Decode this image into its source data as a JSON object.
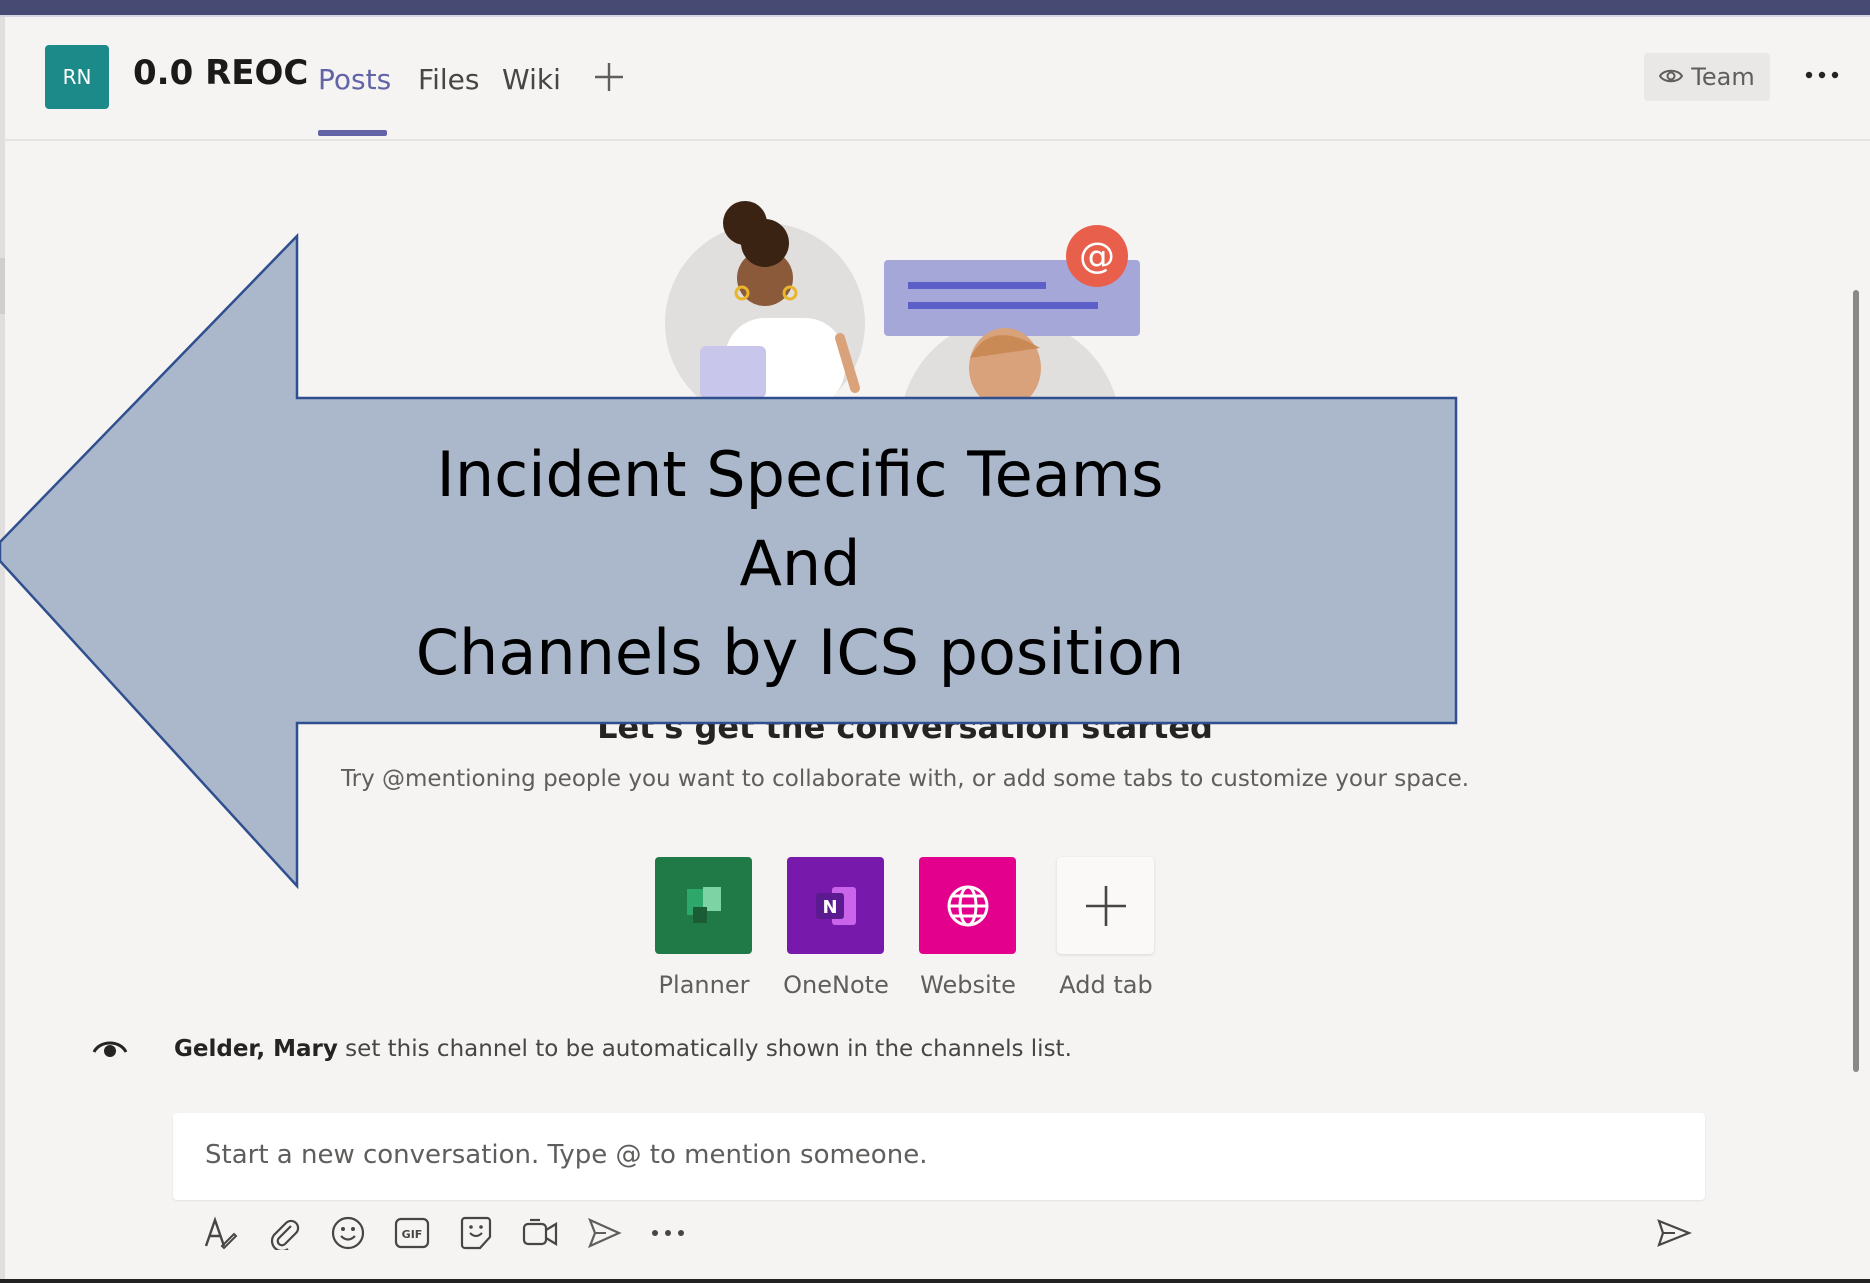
{
  "header": {
    "avatar_initials": "RN",
    "team_name": "0.0 REOC",
    "tabs": [
      {
        "label": "Posts",
        "active": true
      },
      {
        "label": "Files",
        "active": false
      },
      {
        "label": "Wiki",
        "active": false
      }
    ],
    "add_tab_icon": "plus-icon",
    "team_button_label": "Team",
    "more_icon": "more-horizontal-icon"
  },
  "empty_state": {
    "title": "Let's get the conversation started",
    "subtitle": "Try @mentioning people you want to collaborate with, or add some tabs to customize your space."
  },
  "apps": [
    {
      "label": "Planner",
      "color": "#1f7a48",
      "icon": "planner-icon"
    },
    {
      "label": "OneNote",
      "color": "#7719aa",
      "icon": "onenote-icon"
    },
    {
      "label": "Website",
      "color": "#e3008c",
      "icon": "globe-icon"
    },
    {
      "label": "Add tab",
      "color": "#faf9f8",
      "icon": "plus-icon"
    }
  ],
  "system_message": {
    "author": "Gelder, Mary",
    "text": " set this channel to be automatically shown in the channels list."
  },
  "compose": {
    "placeholder": "Start a new conversation. Type @ to mention someone."
  },
  "toolbar_icons": [
    "format-icon",
    "attach-icon",
    "emoji-icon",
    "gif-icon",
    "sticker-icon",
    "meet-now-icon",
    "stream-icon",
    "more-options-icon",
    "send-icon"
  ],
  "overlay": {
    "line1": "Incident Specific Teams",
    "line2": "And",
    "line3": "Channels by ICS position",
    "fill": "#abb8cc",
    "stroke": "#2f4f8f"
  },
  "colors": {
    "accent": "#6264a7",
    "avatar": "#1d8a8a",
    "topbar": "#474a72"
  }
}
